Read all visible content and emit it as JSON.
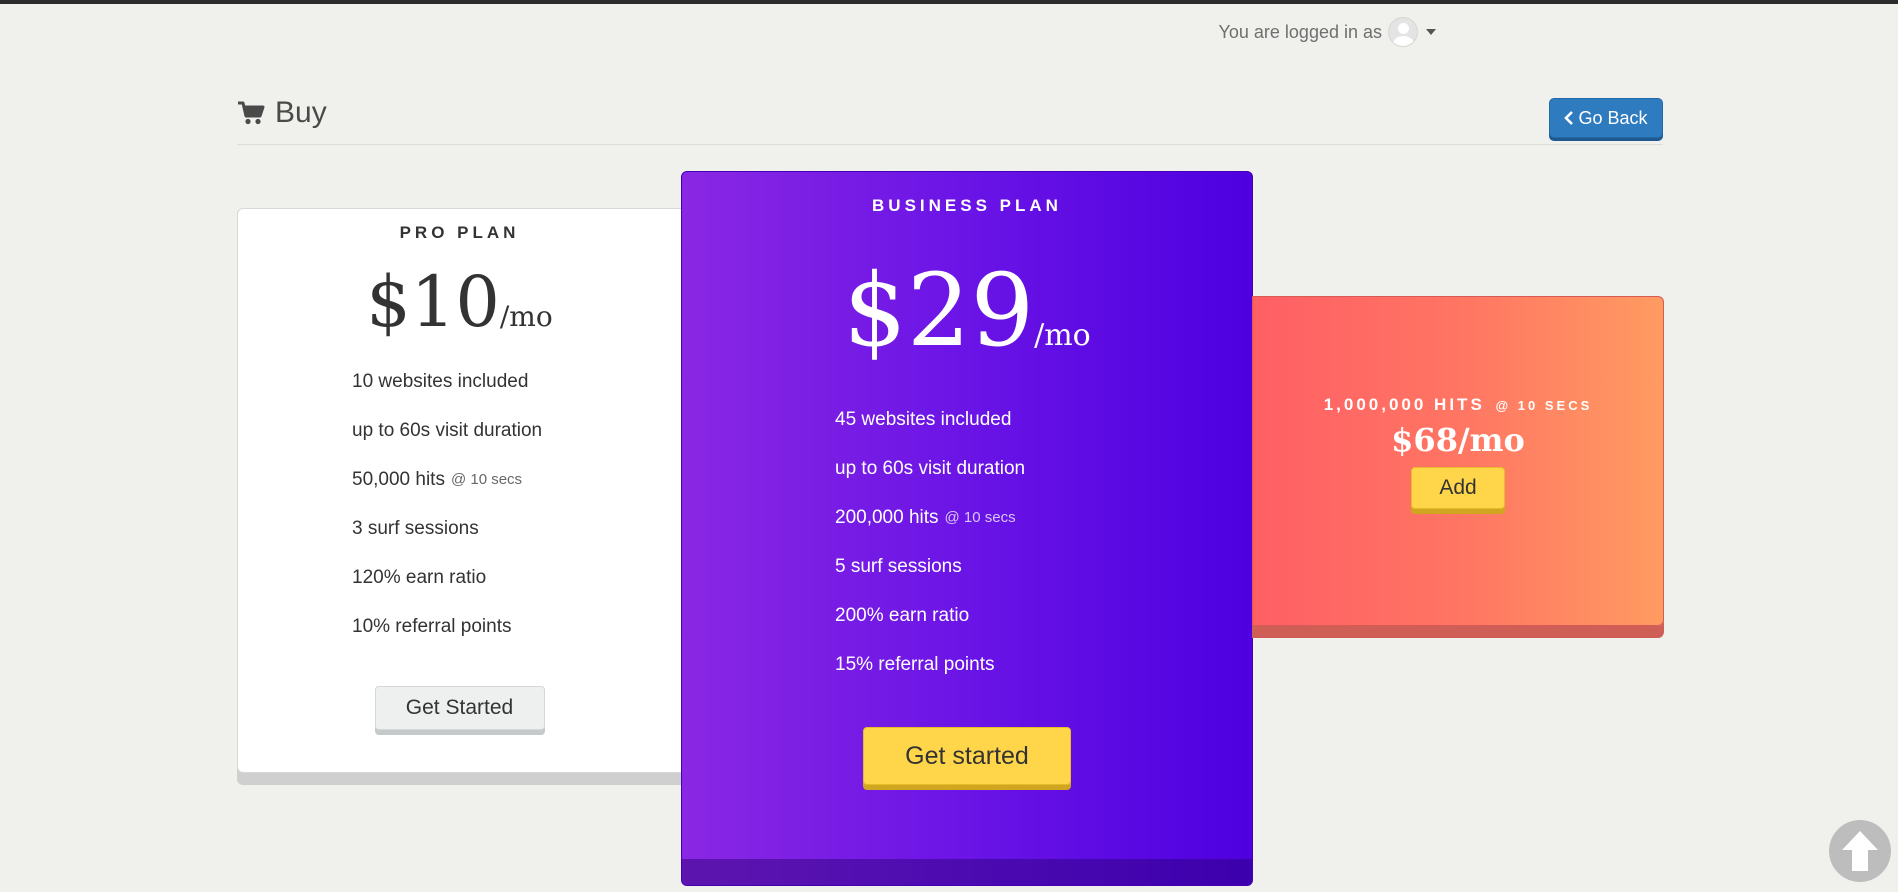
{
  "user": {
    "label": "You are logged in as"
  },
  "page": {
    "title": "Buy",
    "go_back_label": "Go Back"
  },
  "plans": [
    {
      "name": "PRO PLAN",
      "price": "$10",
      "period": "/mo",
      "features": [
        {
          "text": "10 websites included"
        },
        {
          "text": "up to 60s visit duration"
        },
        {
          "text": "50,000 hits",
          "sub": "@ 10 secs"
        },
        {
          "text": "3 surf sessions"
        },
        {
          "text": "120% earn ratio"
        },
        {
          "text": "10% referral points"
        }
      ],
      "button": "Get Started"
    },
    {
      "name": "BUSINESS PLAN",
      "price": "$29",
      "period": "/mo",
      "features": [
        {
          "text": "45 websites included"
        },
        {
          "text": "up to 60s visit duration"
        },
        {
          "text": "200,000 hits",
          "sub": "@ 10 secs"
        },
        {
          "text": "5 surf sessions"
        },
        {
          "text": "200% earn ratio"
        },
        {
          "text": "15% referral points"
        }
      ],
      "button": "Get started"
    }
  ],
  "addon": {
    "name": "1,000,000 HITS",
    "sub": "@ 10 SECS",
    "price": "$68/mo",
    "button": "Add"
  },
  "colors": {
    "business_gradient": [
      "#8a27e3",
      "#4e00e0"
    ],
    "addon_gradient": [
      "#ff5f64",
      "#ff9b61"
    ],
    "yellow_button": "#ffd64a",
    "go_back": "#2f7bc0"
  }
}
